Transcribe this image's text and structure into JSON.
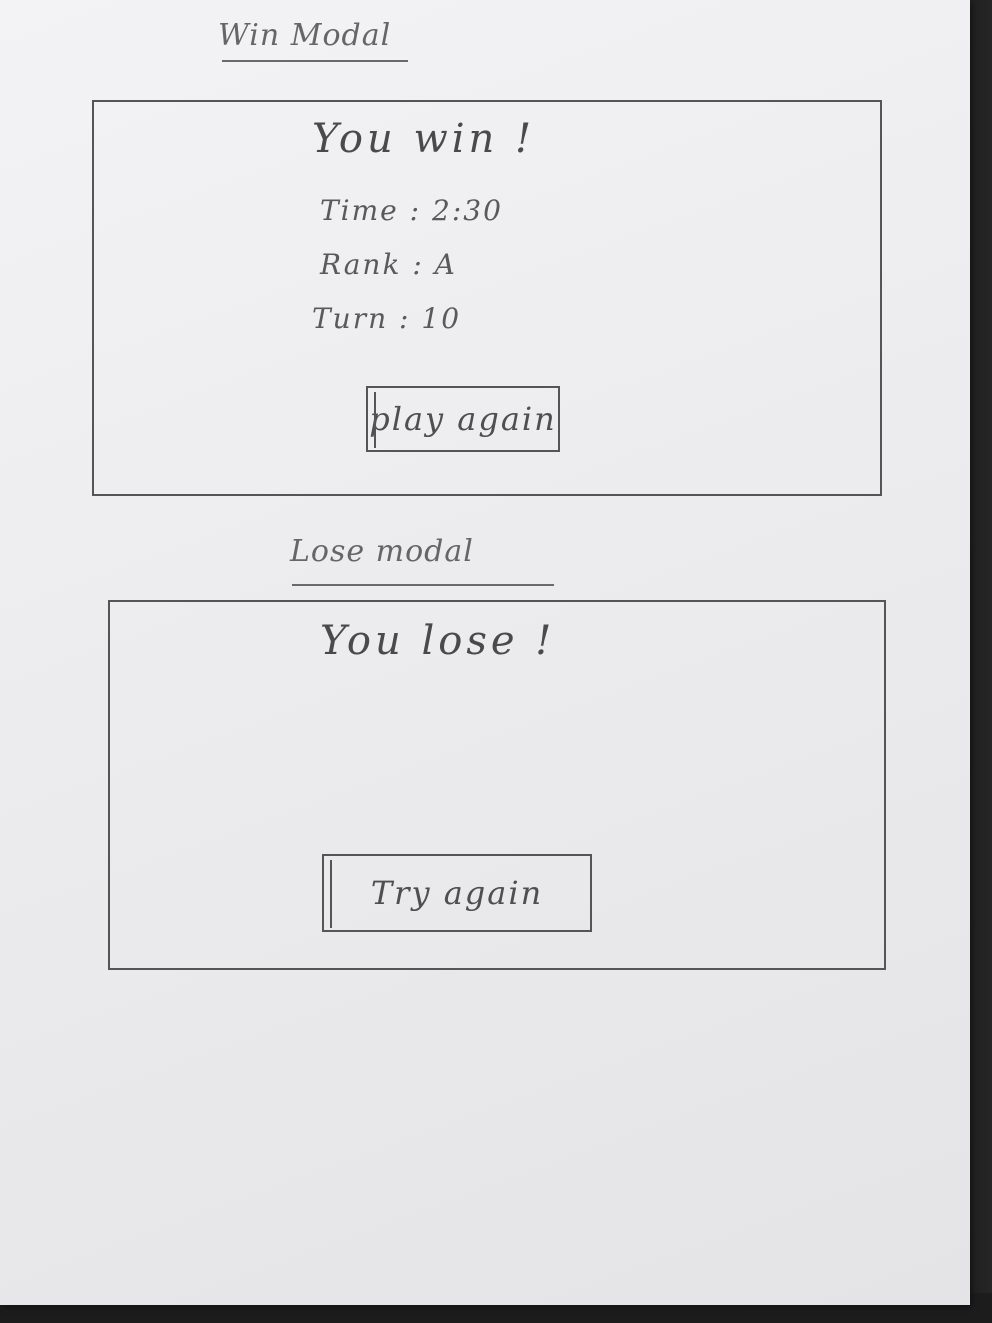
{
  "win_section": {
    "title": "Win Modal",
    "heading": "You win !",
    "stats": [
      {
        "label": "Time",
        "value": "2:30"
      },
      {
        "label": "Rank",
        "value": "A"
      },
      {
        "label": "Turn",
        "value": "10"
      }
    ],
    "button_label": "play again"
  },
  "lose_section": {
    "title": "Lose modal",
    "heading": "You lose !",
    "button_label": "Try again"
  }
}
